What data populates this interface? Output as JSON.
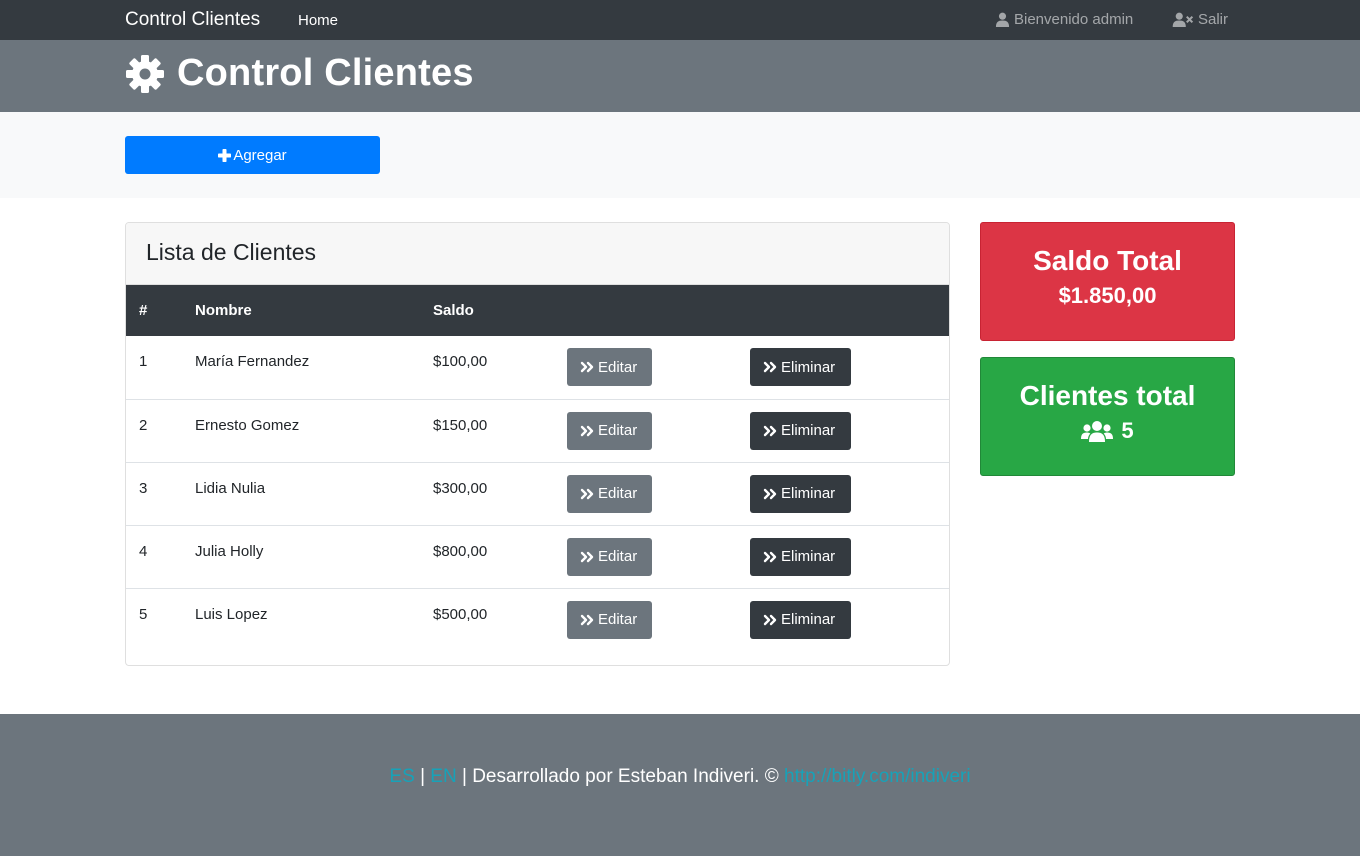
{
  "navbar": {
    "brand": "Control Clientes",
    "home": "Home",
    "welcome": "Bienvenido admin",
    "logout": "Salir",
    "icons": {
      "user": "user-icon",
      "logout": "user-times-icon"
    }
  },
  "header": {
    "title": "Control Clientes",
    "icon": "gear-icon"
  },
  "actions": {
    "add_label": "Agregar",
    "add_icon": "plus-icon"
  },
  "clients": {
    "title": "Lista de Clientes",
    "columns": [
      "#",
      "Nombre",
      "Saldo"
    ],
    "edit_label": "Editar",
    "delete_label": "Eliminar",
    "rows": [
      {
        "num": "1",
        "name": "María Fernandez",
        "saldo": "$100,00"
      },
      {
        "num": "2",
        "name": "Ernesto Gomez",
        "saldo": "$150,00"
      },
      {
        "num": "3",
        "name": "Lidia Nulia",
        "saldo": "$300,00"
      },
      {
        "num": "4",
        "name": "Julia Holly",
        "saldo": "$800,00"
      },
      {
        "num": "5",
        "name": "Luis Lopez",
        "saldo": "$500,00"
      }
    ]
  },
  "stats": {
    "saldo_title": "Saldo Total",
    "saldo_value": "$1.850,00",
    "clientes_title": "Clientes total",
    "clientes_value": "5",
    "clientes_icon": "users-icon"
  },
  "footer": {
    "lang_es": "ES",
    "lang_en": "EN",
    "separator": "|",
    "credit": "Desarrollado por Esteban Indiveri. ©",
    "link": "http://bitly.com/indiveri"
  },
  "colors": {
    "navbar": "#343a40",
    "header": "#6c757d",
    "primary": "#007bff",
    "danger": "#dc3545",
    "success": "#28a745",
    "link": "#17a2b8"
  }
}
